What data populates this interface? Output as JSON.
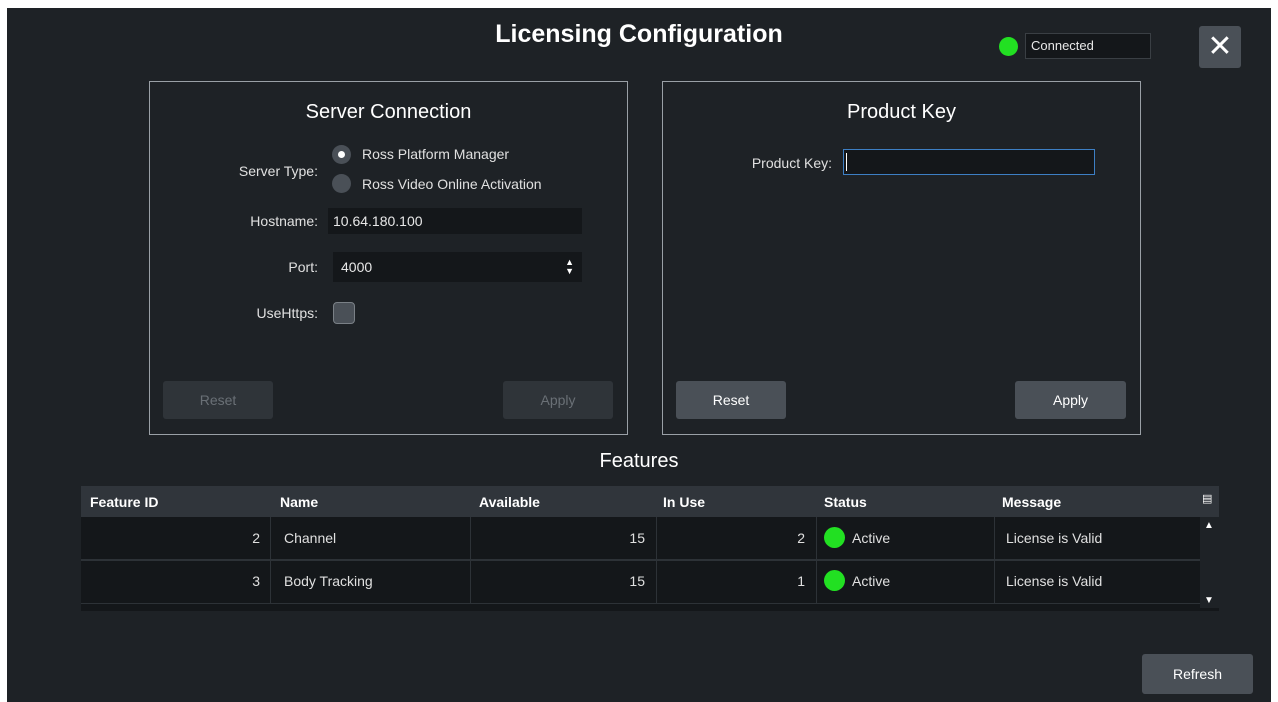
{
  "window": {
    "title": "Licensing Configuration"
  },
  "connection_status": {
    "text": "Connected",
    "color": "#22e022"
  },
  "close_button": {
    "label": "✕",
    "icon": "close-icon"
  },
  "server_connection": {
    "title": "Server Connection",
    "server_type_label": "Server Type:",
    "options": [
      {
        "label": "Ross Platform Manager",
        "selected": true
      },
      {
        "label": "Ross Video Online Activation",
        "selected": false
      }
    ],
    "hostname_label": "Hostname:",
    "hostname_value": "10.64.180.100",
    "port_label": "Port:",
    "port_value": "4000",
    "usehttps_label": "UseHttps:",
    "usehttps_checked": false,
    "reset_label": "Reset",
    "apply_label": "Apply"
  },
  "product_key": {
    "title": "Product Key",
    "key_label": "Product Key:",
    "key_value": "",
    "reset_label": "Reset",
    "apply_label": "Apply"
  },
  "features": {
    "title": "Features",
    "columns": [
      "Feature ID",
      "Name",
      "Available",
      "In Use",
      "Status",
      "Message"
    ],
    "rows": [
      {
        "id": "2",
        "name": "Channel",
        "available": "15",
        "in_use": "2",
        "status": "Active",
        "message": "License is Valid"
      },
      {
        "id": "3",
        "name": "Body Tracking",
        "available": "15",
        "in_use": "1",
        "status": "Active",
        "message": "License is Valid"
      }
    ]
  },
  "refresh_label": "Refresh",
  "colors": {
    "background": "#1e2226",
    "active": "#22e022",
    "button": "#4a5057"
  }
}
